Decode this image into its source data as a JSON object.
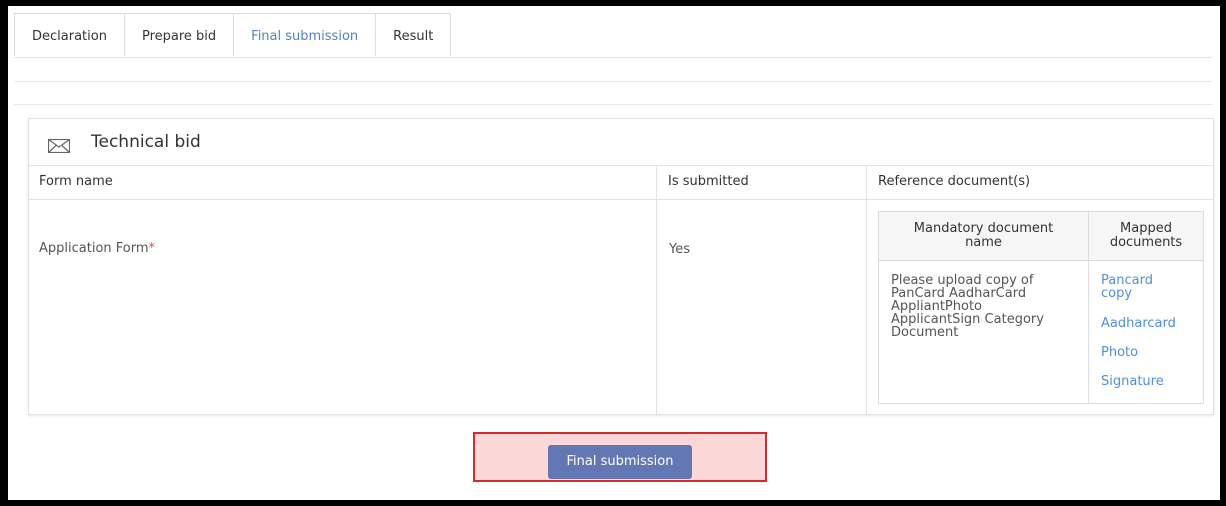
{
  "tabs": [
    {
      "label": "Declaration"
    },
    {
      "label": "Prepare bid"
    },
    {
      "label": "Final submission"
    },
    {
      "label": "Result"
    }
  ],
  "active_tab": "Final submission",
  "colors": {
    "link": "#4f8fd9",
    "active_tab": "#4f83c4",
    "button": "#6277b3",
    "required": "#d9534f",
    "highlight_border": "#d42a2a"
  },
  "panel": {
    "title": "Technical bid",
    "icon": "envelope-icon",
    "columns": {
      "form_name": "Form name",
      "is_submitted": "Is submitted",
      "reference": "Reference document(s)"
    },
    "row": {
      "form_name": "Application Form",
      "required_marker": "*",
      "is_submitted": "Yes"
    },
    "reference_table": {
      "header_doc_line1": "Mandatory document",
      "header_doc_line2": "name",
      "header_mapped_line1": "Mapped",
      "header_mapped_line2": "documents",
      "description_lines": [
        "Please upload copy of",
        "PanCard AadharCard",
        "AppliantPhoto",
        "ApplicantSign Category",
        "Document"
      ],
      "mapped_documents": [
        {
          "line1": "Pancard",
          "line2": "copy"
        },
        {
          "line1": "Aadharcard",
          "line2": ""
        },
        {
          "line1": "Photo",
          "line2": ""
        },
        {
          "line1": "Signature",
          "line2": ""
        }
      ]
    }
  },
  "submit_button": {
    "label": "Final submission"
  }
}
